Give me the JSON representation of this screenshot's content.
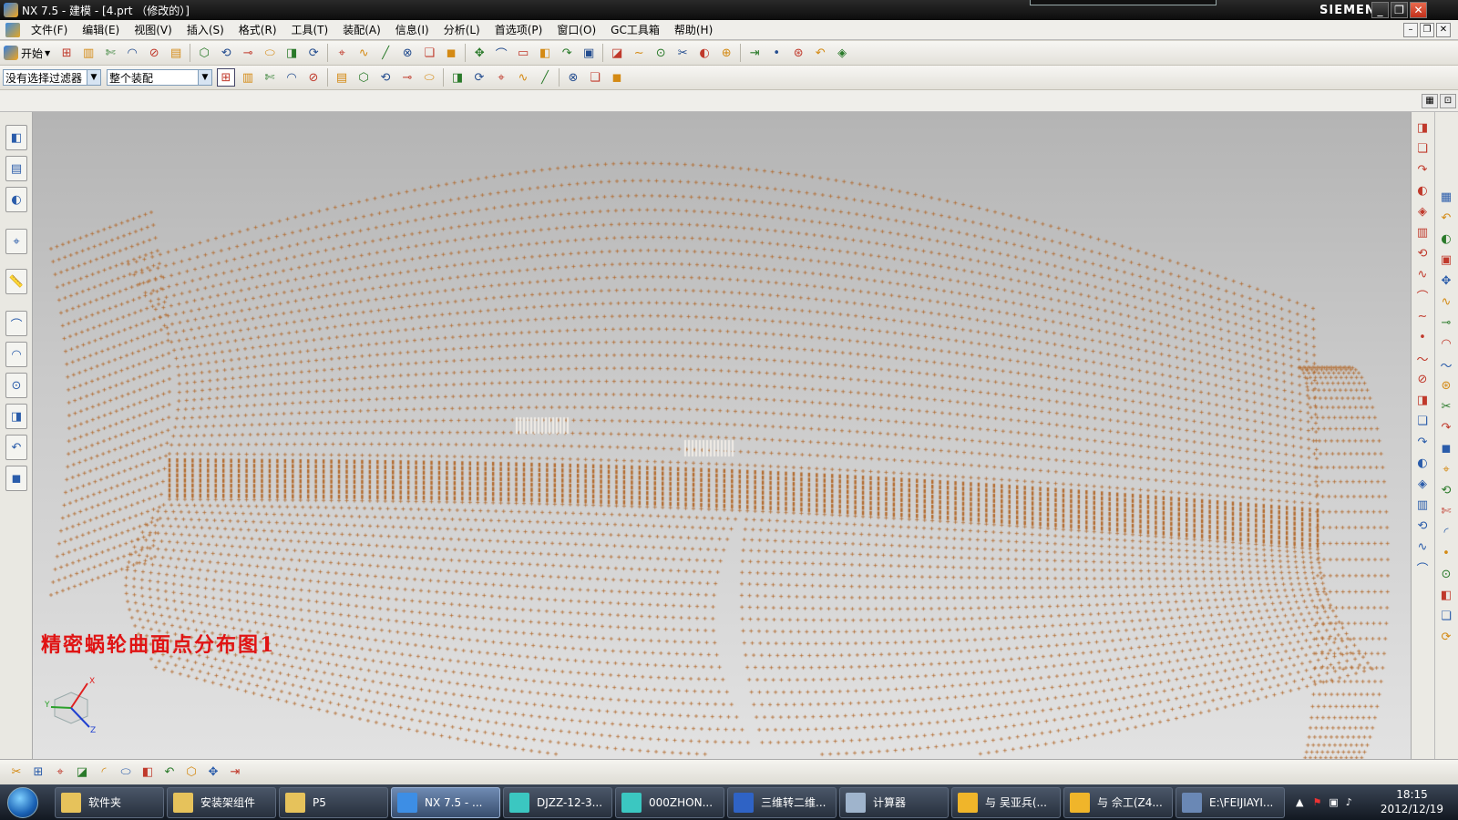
{
  "window": {
    "title": "NX 7.5 - 建模 - [4.prt （修改的）]",
    "brand": "SIEMENS",
    "controls": {
      "minimize": "_",
      "restore": "❐",
      "close": "✕"
    }
  },
  "menubar": {
    "items": [
      "文件(F)",
      "编辑(E)",
      "视图(V)",
      "插入(S)",
      "格式(R)",
      "工具(T)",
      "装配(A)",
      "信息(I)",
      "分析(L)",
      "首选项(P)",
      "窗口(O)",
      "GC工具箱",
      "帮助(H)"
    ],
    "mdi_controls": {
      "minimize": "–",
      "restore": "❐",
      "close": "✕"
    }
  },
  "toolbar1": {
    "start_label": "开始",
    "icons": [
      "new-file-icon",
      "open-file-icon",
      "save-icon",
      "cut-icon",
      "copy-icon",
      "paste-icon",
      "undo-icon",
      "redo-icon",
      "repeat-command-icon",
      "snap-view-icon",
      "display-mode-icon",
      "shaded-icon",
      "edge-display-icon",
      "face-analysis-icon",
      "hide-icon",
      "orient-view-icon",
      "layout-icon",
      "zoom-icon",
      "pan-icon",
      "rotate-icon",
      "measure-icon",
      "section-icon",
      "curve-icon",
      "trim-curve-icon",
      "extend-curve-icon",
      "bridge-curve-icon",
      "offset-curve-icon",
      "fillet-icon",
      "spline-icon",
      "line-icon",
      "arc-icon",
      "point-icon",
      "rectangle-icon",
      "ellipse-icon",
      "wave-icon"
    ]
  },
  "toolbar2": {
    "filter_combo": "没有选择过滤器",
    "scope_combo": "整个装配",
    "icons": [
      "selection-icon",
      "undo-select-icon",
      "deselect-icon",
      "lasso-icon",
      "rectangle-select-icon",
      "snap-endpoint-icon",
      "snap-midpoint-icon",
      "snap-control-icon",
      "snap-intersection-icon",
      "snap-center-icon",
      "snap-quadrant-icon",
      "snap-existing-icon",
      "snap-point-on-curve-icon",
      "snap-point-on-face-icon",
      "view-top-icon",
      "view-front-icon",
      "view-right-icon",
      "view-iso-icon"
    ]
  },
  "resource_bar": {
    "tabs": [
      "assembly-navigator-icon",
      "constraint-navigator-icon",
      "part-navigator-icon",
      "reuse-library-icon",
      "hd3d-tools-icon",
      "history-icon",
      "system-materials-icon",
      "process-studio-icon",
      "manufacturing-wizards-icon",
      "roles-icon",
      "system-visualization-icon"
    ]
  },
  "viewport": {
    "caption": "精密蜗轮曲面点分布图1",
    "point_color": "#b36a2c",
    "triad_labels": {
      "x": "X",
      "y": "Y",
      "z": "Z"
    }
  },
  "right_toolbars": {
    "bar1": [
      "line-icon",
      "tangent-line-icon",
      "bisector-icon",
      "normal-icon",
      "point-icon",
      "circle-icon",
      "arc-icon",
      "curve-icon",
      "circle-center-icon",
      "circle-3pt-icon",
      "circle-tangent-icon",
      "circle-radius-icon",
      "ellipse-icon",
      "polygon-icon",
      "dot-icon",
      "chamfer-icon",
      "extrude-icon",
      "revolve-icon",
      "sweep-icon",
      "mesh-icon",
      "offset-icon",
      "thicken-icon"
    ],
    "bar2": [
      "block-icon",
      "cylinder-icon",
      "cone-icon",
      "sphere-icon",
      "boolean-icon",
      "unite-icon",
      "subtract-icon",
      "hole-icon",
      "boss-icon",
      "pocket-icon",
      "pad-icon",
      "slot-icon",
      "groove-icon",
      "thread-icon",
      "blend-icon",
      "chamfer-edge-icon",
      "shell-icon",
      "draft-icon",
      "trim-body-icon",
      "split-body-icon",
      "pattern-icon",
      "mirror-icon"
    ]
  },
  "bottom_toolbar": {
    "icons": [
      "spline-tool-icon",
      "surface-tool-icon",
      "sketch-icon",
      "constraint-icon",
      "dimension-icon",
      "assembly-icon",
      "component-icon",
      "move-icon",
      "info-icon",
      "layer-icon",
      "settings-icon"
    ]
  },
  "taskbar": {
    "items": [
      {
        "label": "软件夹",
        "icon": "folder-icon",
        "color": "#e6c25b"
      },
      {
        "label": "安装架组件",
        "icon": "folder-icon",
        "color": "#e6c25b"
      },
      {
        "label": "P5",
        "icon": "folder-icon",
        "color": "#e6c25b"
      },
      {
        "label": "NX 7.5 - ...",
        "icon": "nx-app-icon",
        "color": "#3d8ee5",
        "active": true
      },
      {
        "label": "DJZZ-12-3...",
        "icon": "viewer-icon",
        "color": "#3bc7c1"
      },
      {
        "label": "000ZHON...",
        "icon": "viewer-icon",
        "color": "#3bc7c1"
      },
      {
        "label": "三维转二维...",
        "icon": "word-icon",
        "color": "#2f63c5"
      },
      {
        "label": "计算器",
        "icon": "calculator-icon",
        "color": "#9fb4cc"
      },
      {
        "label": "与 吴亚兵(...",
        "icon": "chat-icon",
        "color": "#f0b52a"
      },
      {
        "label": "与 佘工(Z4...",
        "icon": "chat-icon",
        "color": "#f0b52a"
      },
      {
        "label": "E:\\FEIJIAYI...",
        "icon": "explorer-icon",
        "color": "#6a88b5"
      }
    ],
    "clock_time": "18:15",
    "clock_date": "2012/12/19"
  }
}
